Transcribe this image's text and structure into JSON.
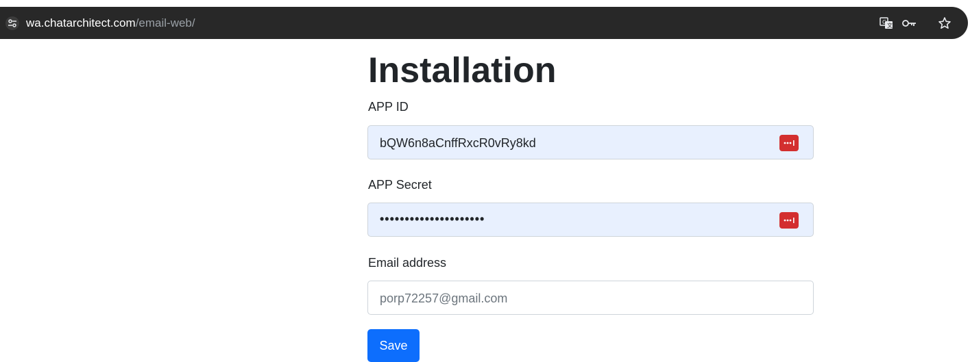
{
  "browser": {
    "url_domain": "wa.chatarchitect.com",
    "url_path": "/email-web/",
    "icons": [
      "site-info-icon",
      "translate-icon",
      "key-icon",
      "star-icon"
    ]
  },
  "form": {
    "title": "Installation",
    "app_id": {
      "label": "APP ID",
      "value": "bQW6n8aCnffRxcR0vRy8kd"
    },
    "app_secret": {
      "label": "APP Secret",
      "value": "•••••••••••••••••••••"
    },
    "email": {
      "label": "Email address",
      "placeholder": "porp72257@gmail.com"
    },
    "save_label": "Save"
  },
  "colors": {
    "primary": "#0d6efd",
    "autofill_bg": "#e8f0fe",
    "password_manager": "#d32f2f"
  }
}
